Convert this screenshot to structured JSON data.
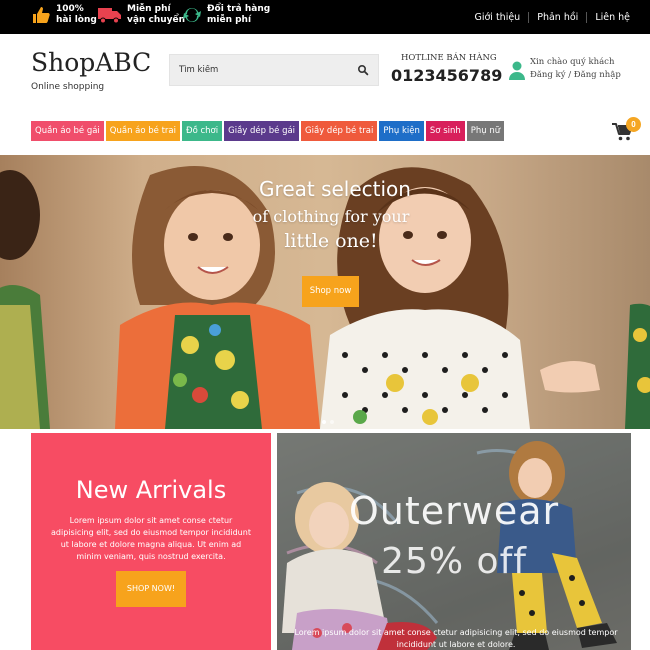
{
  "topbar": {
    "promos": [
      {
        "icon": "thumbs-up-icon",
        "line1": "100%",
        "line2": "hài lòng"
      },
      {
        "icon": "delivery-truck-icon",
        "line1": "Miễn phí",
        "line2": "vận chuyển"
      },
      {
        "icon": "refresh-icon",
        "line1": "Đổi trả hàng",
        "line2": "miễn phí"
      }
    ],
    "links": [
      "Giới thiệu",
      "Phản hồi",
      "Liên hệ"
    ]
  },
  "header": {
    "logo": "ShopABC",
    "tagline": "Online shopping",
    "search_placeholder": "Tìm kiếm",
    "hotline_label": "HOTLINE BÁN HÀNG",
    "hotline_number": "0123456789",
    "greeting": "Xin chào quý khách",
    "auth_links": "Đăng ký / Đăng nhập"
  },
  "nav": {
    "items": [
      {
        "label": "Quần áo bé gái",
        "color": "#f04e6b"
      },
      {
        "label": "Quần áo bé trai",
        "color": "#f7a31c"
      },
      {
        "label": "Đồ chơi",
        "color": "#3cb88a"
      },
      {
        "label": "Giầy dép bé gái",
        "color": "#5b3a8c"
      },
      {
        "label": "Giầy dép bé trai",
        "color": "#ef5a3c"
      },
      {
        "label": "Phụ kiện",
        "color": "#1e6ec8"
      },
      {
        "label": "Sơ sinh",
        "color": "#d81f5b"
      },
      {
        "label": "Phụ nữ",
        "color": "#777777"
      }
    ],
    "cart_count": "0"
  },
  "hero": {
    "line1": "Great selection",
    "line2": "of clothing for your",
    "line3": "little one!",
    "button": "Shop now",
    "slide_count": 2,
    "active_slide": 1
  },
  "banners": {
    "new_arrivals": {
      "title": "New Arrivals",
      "text": "Lorem ipsum dolor sit amet conse ctetur adipisicing elit, sed do eiusmod tempor incididunt ut labore et dolore magna aliqua. Ut enim ad minim veniam, quis nostrud exercita.",
      "button": "SHOP NOW!",
      "color": "#f74c63"
    },
    "outerwear": {
      "title": "Outerwear",
      "subtitle": "25% off",
      "text": "Lorem ipsum dolor sit amet conse ctetur adipisicing elit, sed do eiusmod tempor incididunt ut labore et dolore."
    }
  }
}
